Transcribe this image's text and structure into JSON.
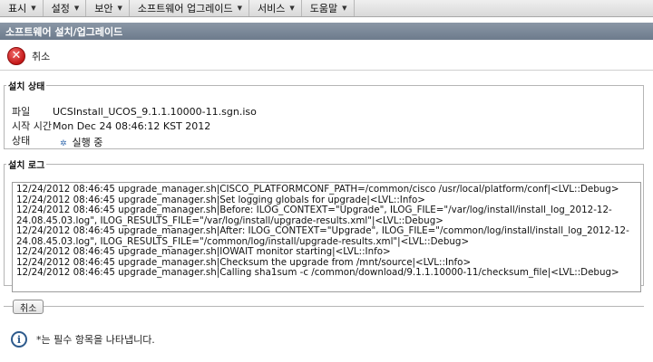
{
  "menu": [
    {
      "label": "표시"
    },
    {
      "label": "설정"
    },
    {
      "label": "보안"
    },
    {
      "label": "소프트웨어 업그레이드"
    },
    {
      "label": "서비스"
    },
    {
      "label": "도움말"
    }
  ],
  "page_title": "소프트웨어 설치/업그레이드",
  "toolbar": {
    "cancel_label": "취소",
    "cancel_icon": "cancel-icon"
  },
  "install_status": {
    "legend": "설치 상태",
    "file_label": "파일",
    "file_value": "UCSInstall_UCOS_9.1.1.10000-11.sgn.iso",
    "start_label": "시작 시간",
    "start_value": "Mon Dec 24 08:46:12 KST 2012",
    "state_label": "상태",
    "state_value": "실행 중"
  },
  "install_log": {
    "legend": "설치 로그",
    "lines": [
      "12/24/2012 08:46:45 upgrade_manager.sh|CISCO_PLATFORMCONF_PATH=/common/cisco /usr/local/platform/conf|<LVL::Debug>",
      "12/24/2012 08:46:45 upgrade_manager.sh|Set logging globals for upgrade|<LVL::Info>",
      "12/24/2012 08:46:45 upgrade_manager.sh|Before: ILOG_CONTEXT=\"Upgrade\", ILOG_FILE=\"/var/log/install/install_log_2012-12-",
      "24.08.45.03.log\", ILOG_RESULTS_FILE=\"/var/log/install/upgrade-results.xml\"|<LVL::Debug>",
      "12/24/2012 08:46:45 upgrade_manager.sh|After: ILOG_CONTEXT=\"Upgrade\", ILOG_FILE=\"/common/log/install/install_log_2012-12-",
      "24.08.45.03.log\", ILOG_RESULTS_FILE=\"/common/log/install/upgrade-results.xml\"|<LVL::Debug>",
      "12/24/2012 08:46:45 upgrade_manager.sh|IOWAIT monitor starting|<LVL::Info>",
      "12/24/2012 08:46:45 upgrade_manager.sh|Checksum the upgrade from /mnt/source|<LVL::Info>",
      "12/24/2012 08:46:45 upgrade_manager.sh|Calling sha1sum -c /common/download/9.1.1.10000-11/checksum_file|<LVL::Debug>"
    ]
  },
  "bottom": {
    "cancel_label": "취소"
  },
  "footer": {
    "note": "*는 필수 항목을 나타냅니다.",
    "info_icon": "info-icon"
  }
}
